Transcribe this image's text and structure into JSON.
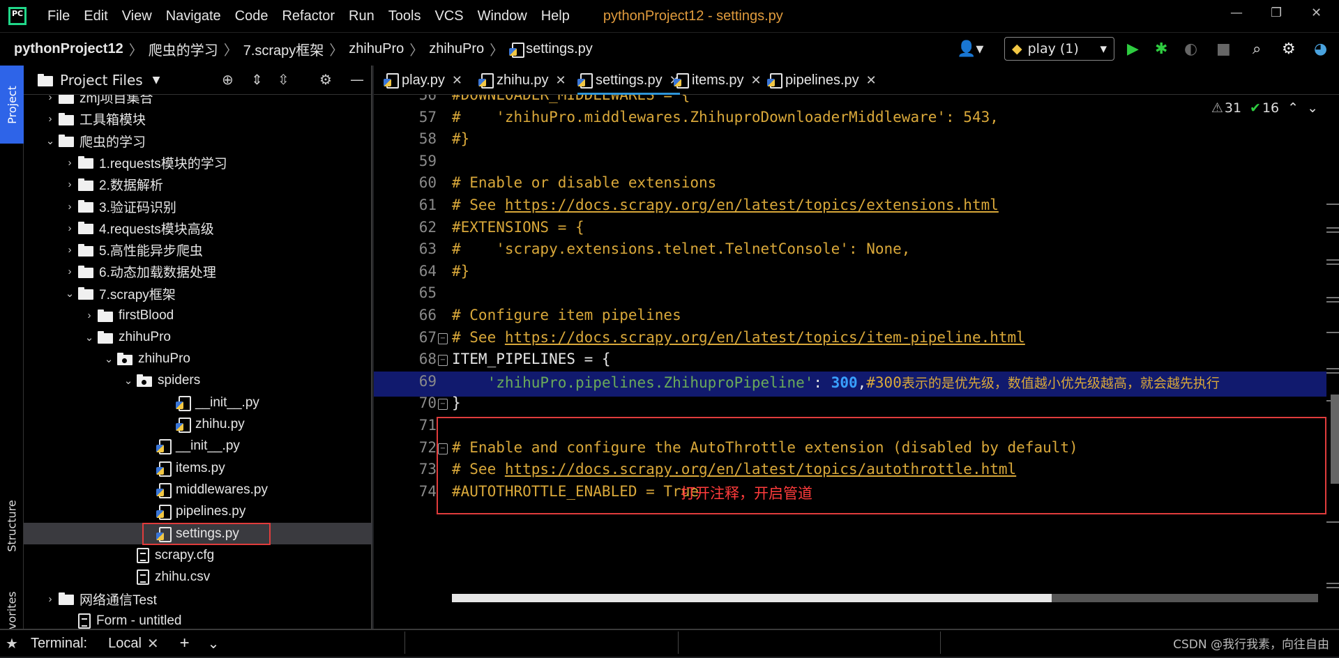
{
  "app": {
    "logo_text": "PC",
    "menu": [
      "File",
      "Edit",
      "View",
      "Navigate",
      "Code",
      "Refactor",
      "Run",
      "Tools",
      "VCS",
      "Window",
      "Help"
    ],
    "window_title": "pythonProject12 - settings.py"
  },
  "breadcrumb": [
    "pythonProject12",
    "爬虫的学习",
    "7.scrapy框架",
    "zhihuPro",
    "zhihuPro",
    "settings.py"
  ],
  "run_config": {
    "label": "play (1)"
  },
  "left_strip": {
    "project": "Project",
    "structure": "Structure",
    "favorites": "Favorites"
  },
  "project_panel": {
    "title": "Project Files",
    "tree": [
      {
        "label": "zmj项目集合",
        "depth": 1,
        "type": "folder",
        "open": false
      },
      {
        "label": "工具箱模块",
        "depth": 1,
        "type": "folder",
        "open": false
      },
      {
        "label": "爬虫的学习",
        "depth": 1,
        "type": "folder",
        "open": true
      },
      {
        "label": "1.requests模块的学习",
        "depth": 2,
        "type": "folder",
        "open": false
      },
      {
        "label": "2.数据解析",
        "depth": 2,
        "type": "folder",
        "open": false
      },
      {
        "label": "3.验证码识别",
        "depth": 2,
        "type": "folder",
        "open": false
      },
      {
        "label": "4.requests模块高级",
        "depth": 2,
        "type": "folder",
        "open": false
      },
      {
        "label": "5.高性能异步爬虫",
        "depth": 2,
        "type": "folder",
        "open": false
      },
      {
        "label": "6.动态加载数据处理",
        "depth": 2,
        "type": "folder",
        "open": false
      },
      {
        "label": "7.scrapy框架",
        "depth": 2,
        "type": "folder",
        "open": true
      },
      {
        "label": "firstBlood",
        "depth": 3,
        "type": "folder",
        "open": false
      },
      {
        "label": "zhihuPro",
        "depth": 3,
        "type": "folder",
        "open": true
      },
      {
        "label": "zhihuPro",
        "depth": 4,
        "type": "package",
        "open": true
      },
      {
        "label": "spiders",
        "depth": 5,
        "type": "package",
        "open": true
      },
      {
        "label": "__init__.py",
        "depth": 7,
        "type": "py"
      },
      {
        "label": "zhihu.py",
        "depth": 7,
        "type": "py"
      },
      {
        "label": "__init__.py",
        "depth": 6,
        "type": "py"
      },
      {
        "label": "items.py",
        "depth": 6,
        "type": "py"
      },
      {
        "label": "middlewares.py",
        "depth": 6,
        "type": "py"
      },
      {
        "label": "pipelines.py",
        "depth": 6,
        "type": "py"
      },
      {
        "label": "settings.py",
        "depth": 6,
        "type": "py",
        "selected": true
      },
      {
        "label": "scrapy.cfg",
        "depth": 5,
        "type": "file"
      },
      {
        "label": "zhihu.csv",
        "depth": 5,
        "type": "file"
      },
      {
        "label": "网络通信Test",
        "depth": 1,
        "type": "folder",
        "open": false
      },
      {
        "label": "Form - untitled",
        "depth": 2,
        "type": "file"
      }
    ]
  },
  "tabs": [
    {
      "label": "play.py"
    },
    {
      "label": "zhihu.py"
    },
    {
      "label": "settings.py",
      "active": true
    },
    {
      "label": "items.py"
    },
    {
      "label": "pipelines.py"
    }
  ],
  "inspections": {
    "warnings": "31",
    "ok": "16"
  },
  "editor": {
    "lines": [
      {
        "n": "56",
        "parts": [
          [
            "cmt",
            "#DOWNLOADER_MIDDLEWARES = {"
          ]
        ]
      },
      {
        "n": "57",
        "parts": [
          [
            "cmt",
            "#    'zhihuPro.middlewares.ZhihuproDownloaderMiddleware': 543,"
          ]
        ]
      },
      {
        "n": "58",
        "parts": [
          [
            "cmt",
            "#}"
          ]
        ]
      },
      {
        "n": "59",
        "parts": []
      },
      {
        "n": "60",
        "parts": [
          [
            "cmt",
            "# Enable or disable extensions"
          ]
        ]
      },
      {
        "n": "61",
        "parts": [
          [
            "cmt",
            "# See "
          ],
          [
            "url",
            "https://docs.scrapy.org/en/latest/topics/extensions.html"
          ]
        ]
      },
      {
        "n": "62",
        "parts": [
          [
            "cmt",
            "#EXTENSIONS = {"
          ]
        ]
      },
      {
        "n": "63",
        "parts": [
          [
            "cmt",
            "#    'scrapy.extensions.telnet.TelnetConsole': None,"
          ]
        ]
      },
      {
        "n": "64",
        "parts": [
          [
            "cmt",
            "#}"
          ]
        ]
      },
      {
        "n": "65",
        "parts": []
      },
      {
        "n": "66",
        "parts": [
          [
            "cmt",
            "# Configure item pipelines"
          ]
        ]
      },
      {
        "n": "67",
        "parts": [
          [
            "cmt",
            "# See "
          ],
          [
            "url",
            "https://docs.scrapy.org/en/latest/topics/item-pipeline.html"
          ]
        ]
      },
      {
        "n": "68",
        "parts": [
          [
            "plain",
            "ITEM_PIPELINES = {"
          ]
        ]
      },
      {
        "n": "69",
        "parts": [
          [
            "plain",
            "    "
          ],
          [
            "str",
            "'zhihuPro.pipelines.ZhihuproPipeline'"
          ],
          [
            "plain",
            ": "
          ],
          [
            "num",
            "300"
          ],
          [
            "plain",
            ","
          ],
          [
            "cmt",
            "#300"
          ],
          [
            "cjk",
            "表示的是优先级，数值越小优先级越高，就会越先执行"
          ]
        ]
      },
      {
        "n": "70",
        "parts": [
          [
            "plain",
            "}"
          ]
        ]
      },
      {
        "n": "71",
        "parts": []
      },
      {
        "n": "72",
        "parts": [
          [
            "cmt",
            "# Enable and configure the AutoThrottle extension (disabled by default)"
          ]
        ]
      },
      {
        "n": "73",
        "parts": [
          [
            "cmt",
            "# See "
          ],
          [
            "url",
            "https://docs.scrapy.org/en/latest/topics/autothrottle.html"
          ]
        ]
      },
      {
        "n": "74",
        "parts": [
          [
            "cmt",
            "#AUTOTHROTTLE_ENABLED = True"
          ]
        ]
      }
    ],
    "current_line": "69",
    "annotation": "打开注释，开启管道"
  },
  "bottom": {
    "terminal_label": "Terminal:",
    "local_tab": "Local",
    "watermark": "CSDN @我行我素，向往自由"
  }
}
